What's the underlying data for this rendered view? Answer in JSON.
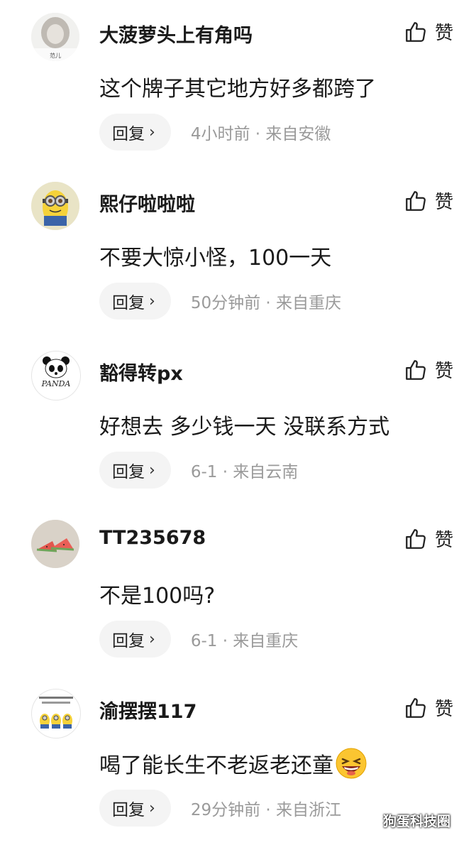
{
  "comments": [
    {
      "username": "大菠萝头上有角吗",
      "avatar_caption": "范儿",
      "content": "这个牌子其它地方好多都跨了",
      "reply_label": "回复",
      "meta": "4小时前 · 来自安徽",
      "like_label": "赞"
    },
    {
      "username": "熙仔啦啦啦",
      "content": "不要大惊小怪，100一天",
      "reply_label": "回复",
      "meta": "50分钟前 · 来自重庆",
      "like_label": "赞"
    },
    {
      "username": "豁得转px",
      "avatar_caption": "PANDA",
      "content": "好想去 多少钱一天 没联系方式",
      "reply_label": "回复",
      "meta": "6-1 · 来自云南",
      "like_label": "赞"
    },
    {
      "username": "TT235678",
      "content": "不是100吗?",
      "reply_label": "回复",
      "meta": "6-1 · 来自重庆",
      "like_label": "赞"
    },
    {
      "username": "渝摆摆117",
      "content": "喝了能长生不老返老还童",
      "reply_label": "回复",
      "meta": "29分钟前 · 来自浙江",
      "like_label": "赞"
    }
  ],
  "watermark": "狗蛋科技圈",
  "icons": {
    "like": "thumbs-up-icon",
    "chevron": "chevron-right-icon",
    "emoji": "laughing-emoji-icon"
  }
}
